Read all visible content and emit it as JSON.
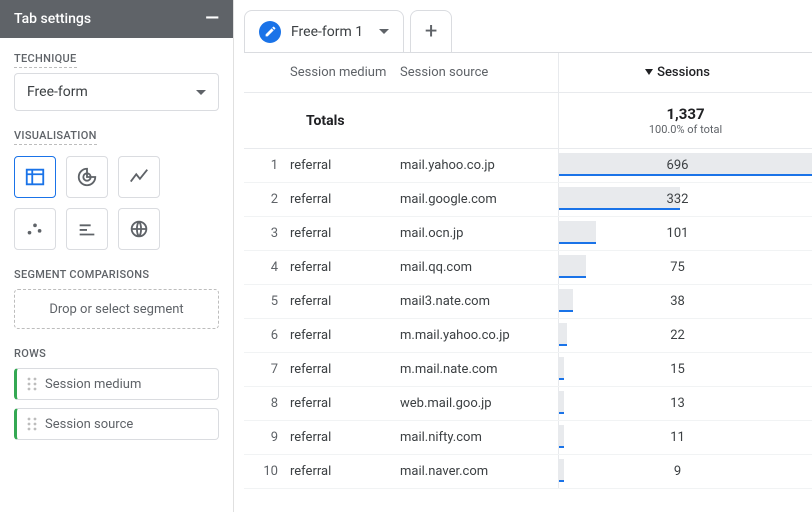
{
  "sidebar": {
    "title": "Tab settings",
    "technique": {
      "label": "TECHNIQUE",
      "value": "Free-form"
    },
    "visualisation": {
      "label": "VISUALISATION"
    },
    "segment": {
      "label": "SEGMENT COMPARISONS",
      "placeholder": "Drop or select segment"
    },
    "rows": {
      "label": "ROWS",
      "items": [
        "Session medium",
        "Session source"
      ]
    }
  },
  "tabs": {
    "active": "Free-form 1"
  },
  "table": {
    "headers": {
      "medium": "Session medium",
      "source": "Session source",
      "sessions": "Sessions"
    },
    "totals": {
      "label": "Totals",
      "value": "1,337",
      "sub": "100.0% of total"
    },
    "rows": [
      {
        "n": 1,
        "medium": "referral",
        "source": "mail.yahoo.co.jp",
        "sessions": 696
      },
      {
        "n": 2,
        "medium": "referral",
        "source": "mail.google.com",
        "sessions": 332
      },
      {
        "n": 3,
        "medium": "referral",
        "source": "mail.ocn.jp",
        "sessions": 101
      },
      {
        "n": 4,
        "medium": "referral",
        "source": "mail.qq.com",
        "sessions": 75
      },
      {
        "n": 5,
        "medium": "referral",
        "source": "mail3.nate.com",
        "sessions": 38
      },
      {
        "n": 6,
        "medium": "referral",
        "source": "m.mail.yahoo.co.jp",
        "sessions": 22
      },
      {
        "n": 7,
        "medium": "referral",
        "source": "m.mail.nate.com",
        "sessions": 15
      },
      {
        "n": 8,
        "medium": "referral",
        "source": "web.mail.goo.jp",
        "sessions": 13
      },
      {
        "n": 9,
        "medium": "referral",
        "source": "mail.nifty.com",
        "sessions": 11
      },
      {
        "n": 10,
        "medium": "referral",
        "source": "mail.naver.com",
        "sessions": 9
      }
    ],
    "max_bar": 696
  },
  "chart_data": {
    "type": "table",
    "title": "Free-form 1 — Sessions by Session medium / Session source",
    "columns": [
      "Session medium",
      "Session source",
      "Sessions"
    ],
    "total_sessions": 1337,
    "series": [
      {
        "medium": "referral",
        "source": "mail.yahoo.co.jp",
        "sessions": 696
      },
      {
        "medium": "referral",
        "source": "mail.google.com",
        "sessions": 332
      },
      {
        "medium": "referral",
        "source": "mail.ocn.jp",
        "sessions": 101
      },
      {
        "medium": "referral",
        "source": "mail.qq.com",
        "sessions": 75
      },
      {
        "medium": "referral",
        "source": "mail3.nate.com",
        "sessions": 38
      },
      {
        "medium": "referral",
        "source": "m.mail.yahoo.co.jp",
        "sessions": 22
      },
      {
        "medium": "referral",
        "source": "m.mail.nate.com",
        "sessions": 15
      },
      {
        "medium": "referral",
        "source": "web.mail.goo.jp",
        "sessions": 13
      },
      {
        "medium": "referral",
        "source": "mail.nifty.com",
        "sessions": 11
      },
      {
        "medium": "referral",
        "source": "mail.naver.com",
        "sessions": 9
      }
    ]
  }
}
